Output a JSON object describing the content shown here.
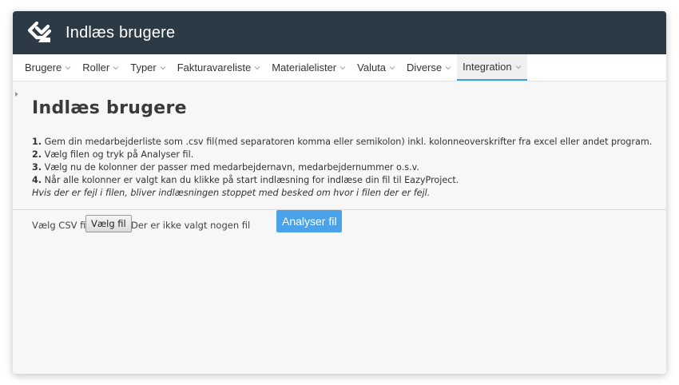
{
  "app": {
    "title": "Indlæs brugere",
    "logo_icon": "eazyproject-logo-icon"
  },
  "nav": {
    "items": [
      {
        "label": "Brugere",
        "active": false
      },
      {
        "label": "Roller",
        "active": false
      },
      {
        "label": "Typer",
        "active": false
      },
      {
        "label": "Fakturavareliste",
        "active": false
      },
      {
        "label": "Materialelister",
        "active": false
      },
      {
        "label": "Valuta",
        "active": false
      },
      {
        "label": "Diverse",
        "active": false
      },
      {
        "label": "Integration",
        "active": true
      }
    ],
    "caret_icon": "chevron-down-icon"
  },
  "page": {
    "title": "Indlæs brugere",
    "steps": [
      {
        "num": "1.",
        "text": "Gem din medarbejderliste som .csv fil(med separatoren komma eller semikolon) inkl. kolonneoverskrifter fra excel eller andet program."
      },
      {
        "num": "2.",
        "text": "Vælg filen og tryk på Analyser fil."
      },
      {
        "num": "3.",
        "text": "Vælg nu de kolonner der passer med medarbejdernavn, medarbejdernummer o.s.v."
      },
      {
        "num": "4.",
        "text": "Når alle kolonner er valgt kan du klikke på start indlæsning for indlæse din fil til EazyProject."
      }
    ],
    "note": "Hvis der er fejl i filen, bliver indlæsningen stoppet med besked om hvor i filen der er fejl."
  },
  "form": {
    "csv_label": "Vælg CSV fil",
    "file_button_label": "Vælg fil",
    "file_status": "Der er ikke valgt nogen fil",
    "analyse_button_label": "Analyser fil"
  },
  "colors": {
    "header_bg": "#2b3a45",
    "accent": "#4aa3e8",
    "active_underline": "#3e9de0"
  }
}
